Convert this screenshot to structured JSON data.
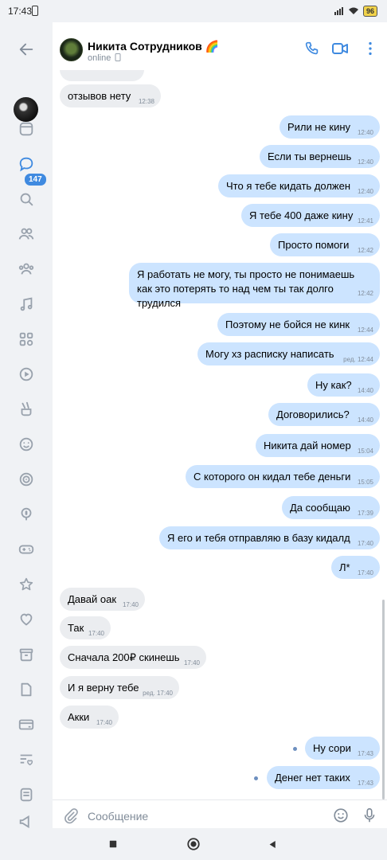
{
  "status_bar": {
    "time": "17:43",
    "battery": "96"
  },
  "nav_rail": {
    "unread_badge": "147"
  },
  "header": {
    "contact_name": "Никита Сотрудников 🌈",
    "status": "online"
  },
  "messages": [
    {
      "dir": "in",
      "text": "отзывов нету",
      "time": "12:38"
    },
    {
      "dir": "out",
      "text": "Рили не кину",
      "time": "12:40"
    },
    {
      "dir": "out",
      "text": "Если ты вернешь",
      "time": "12:40"
    },
    {
      "dir": "out",
      "text": "Что я тебе кидать должен",
      "time": "12:40"
    },
    {
      "dir": "out",
      "text": "Я тебе 400 даже кину",
      "time": "12:41"
    },
    {
      "dir": "out",
      "text": "Просто помоги",
      "time": "12:42"
    },
    {
      "dir": "out",
      "text": "Я работать не могу, ты просто не понимаешь как это потерять то над чем ты так долго трудился",
      "time": "12:42"
    },
    {
      "dir": "out",
      "text": "Поэтому не бойся не кинк",
      "time": "12:44"
    },
    {
      "dir": "out",
      "text": "Могу хз расписку написать",
      "time": "ред. 12:44"
    },
    {
      "dir": "out",
      "text": "Ну как?",
      "time": "14:40"
    },
    {
      "dir": "out",
      "text": "Договорились?",
      "time": "14:40"
    },
    {
      "dir": "out",
      "text": "Никита дай номер",
      "time": "15:04"
    },
    {
      "dir": "out",
      "text": "С которого он кидал тебе деньги",
      "time": "15:05"
    },
    {
      "dir": "out",
      "text": "Да сообщаю",
      "time": "17:39"
    },
    {
      "dir": "out",
      "text": "Я его и тебя отправляю в базу кидалд",
      "time": "17:40"
    },
    {
      "dir": "out",
      "text": "Л*",
      "time": "17:40"
    },
    {
      "dir": "in",
      "text": "Давай оак",
      "time": "17:40"
    },
    {
      "dir": "in",
      "text": "Так",
      "time": "17:40"
    },
    {
      "dir": "in",
      "text": "Сначала 200₽ скинешь",
      "time": "17:40"
    },
    {
      "dir": "in",
      "text": "И я верну тебе",
      "time": "ред. 17:40"
    },
    {
      "dir": "in",
      "text": "Акки",
      "time": "17:40"
    },
    {
      "dir": "out",
      "text": "Ну сори",
      "time": "17:43",
      "unread": true
    },
    {
      "dir": "out",
      "text": "Денег нет таких",
      "time": "17:43",
      "unread": true
    }
  ],
  "composer": {
    "placeholder": "Сообщение"
  },
  "colors": {
    "accent": "#3f8ae0",
    "bubble_out": "#cce4ff",
    "bubble_in": "#ebedf0"
  }
}
